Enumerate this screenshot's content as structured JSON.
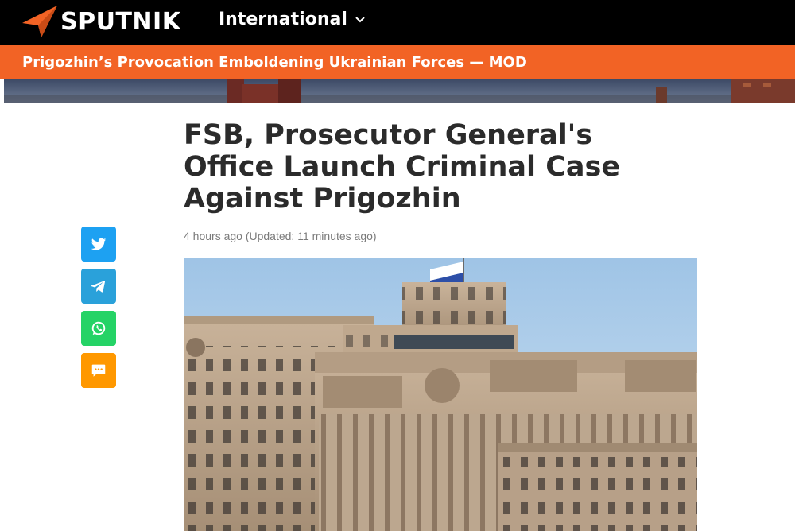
{
  "header": {
    "logo_text": "SPUTNIK",
    "edition_label": "International"
  },
  "breaking": {
    "text": "Prigozhin’s Provocation Emboldening Ukrainian Forces — MOD"
  },
  "article": {
    "headline": "FSB, Prosecutor General's Office Launch Criminal Case Against Prigozhin",
    "timestamp": "4 hours ago (Updated: 11 minutes ago)"
  },
  "share": [
    {
      "name": "twitter",
      "icon": "twitter-icon",
      "color": "#1da1f2"
    },
    {
      "name": "telegram",
      "icon": "telegram-icon",
      "color": "#2aa1da"
    },
    {
      "name": "whatsapp",
      "icon": "whatsapp-icon",
      "color": "#25d366"
    },
    {
      "name": "comments",
      "icon": "comment-icon",
      "color": "#ff9800"
    }
  ],
  "colors": {
    "header_bg": "#000000",
    "breaking_bg": "#f26325",
    "logo_accent": "#f26325",
    "headline": "#2b2b2b"
  }
}
